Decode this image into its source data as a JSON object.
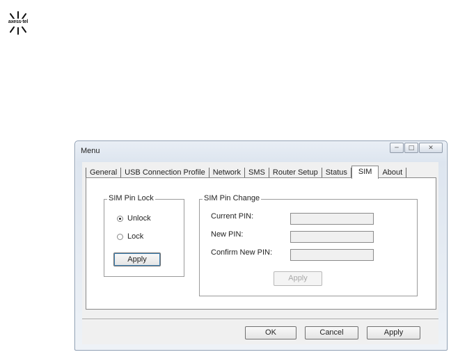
{
  "logo": {
    "brand": "axess·tel"
  },
  "window": {
    "title": "Menu",
    "controls": [
      "minimize-icon",
      "maximize-icon",
      "close-icon"
    ]
  },
  "tabs": [
    {
      "label": "General",
      "active": false
    },
    {
      "label": "USB Connection Profile",
      "active": false
    },
    {
      "label": "Network",
      "active": false
    },
    {
      "label": "SMS",
      "active": false
    },
    {
      "label": "Router Setup",
      "active": false
    },
    {
      "label": "Status",
      "active": false
    },
    {
      "label": "SIM",
      "active": true
    },
    {
      "label": "About",
      "active": false
    }
  ],
  "sim_pin_lock": {
    "title": "SIM Pin Lock",
    "unlock_label": "Unlock",
    "lock_label": "Lock",
    "selected": "Unlock",
    "apply_label": "Apply"
  },
  "sim_pin_change": {
    "title": "SIM Pin Change",
    "current_pin_label": "Current PIN:",
    "new_pin_label": "New PIN:",
    "confirm_pin_label": "Confirm New PIN:",
    "current_pin_value": "",
    "new_pin_value": "",
    "confirm_pin_value": "",
    "apply_label": "Apply"
  },
  "footer": {
    "ok_label": "OK",
    "cancel_label": "Cancel",
    "apply_label": "Apply"
  }
}
